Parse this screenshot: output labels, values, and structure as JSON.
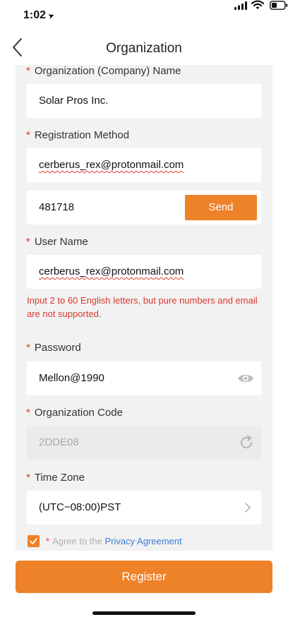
{
  "status_bar": {
    "time": "1:02",
    "location_glyph": "➤"
  },
  "nav": {
    "title": "Organization"
  },
  "form": {
    "required_mark": "*",
    "org_name": {
      "label": "Organization (Company) Name",
      "value": "Solar Pros Inc."
    },
    "registration": {
      "label": "Registration Method",
      "value": "cerberus_rex@protonmail.com"
    },
    "verification": {
      "value": "481718",
      "send_label": "Send"
    },
    "username": {
      "label": "User Name",
      "value": "cerberus_rex@protonmail.com",
      "hint": "Input 2 to 60 English letters, but pure numbers and email are not supported."
    },
    "password": {
      "label": "Password",
      "value": "Mellon@1990"
    },
    "org_code": {
      "label": "Organization Code",
      "value": "2DDE08"
    },
    "timezone": {
      "label": "Time Zone",
      "value": "(UTC−08:00)PST"
    },
    "agreement": {
      "checked": true,
      "prefix": "Agree to the",
      "link": "Privacy Agreement"
    }
  },
  "register": {
    "label": "Register"
  },
  "colors": {
    "accent": "#ee8228",
    "error": "#d9382c",
    "link": "#3b7bd6"
  }
}
